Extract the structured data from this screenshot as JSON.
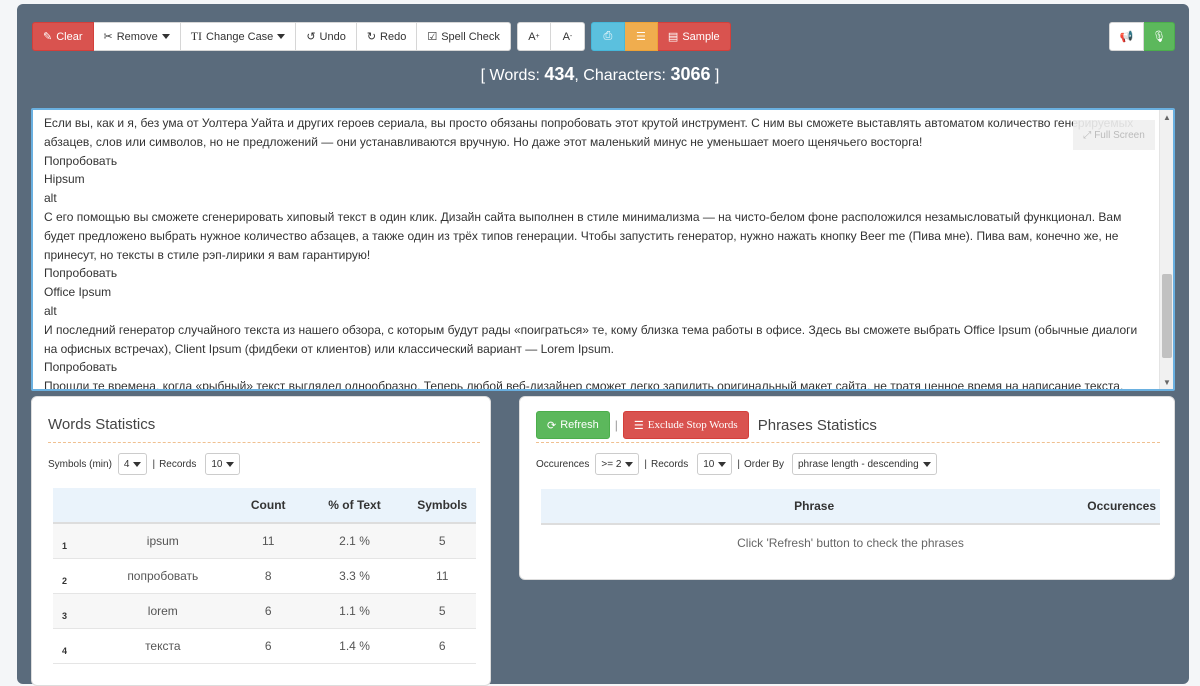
{
  "toolbar": {
    "clear": "Clear",
    "remove": "Remove",
    "change_case": "Change Case",
    "undo": "Undo",
    "redo": "Redo",
    "spell_check": "Spell Check",
    "font_up": "A",
    "font_up_sup": "+",
    "font_down": "A",
    "font_down_sup": "-",
    "sample": "Sample"
  },
  "counter": {
    "open": "[ ",
    "words_label": "Words:",
    "words_value": "434",
    "chars_label": ", Characters:",
    "chars_value": "3066",
    "close": " ]"
  },
  "editor": {
    "fullscreen_label": "Full Screen",
    "lines": [
      "Если вы, как и я, без ума от Уолтера Уайта и других героев сериала, вы просто обязаны попробовать этот крутой инструмент. С ним вы сможете выставлять автоматом количество генерируемых абзацев, слов или символов, но не предложений — они устанавливаются вручную. Но даже этот маленький минус не уменьшает моего щенячьего восторга!",
      "Попробовать",
      "Hipsum",
      " alt",
      "С его помощью вы сможете сгенерировать хиповый текст в один клик. Дизайн сайта выполнен в стиле минимализма — на чисто-белом фоне расположился незамысловатый функционал. Вам будет предложено выбрать нужное количество абзацев, а также один из трёх типов генерации. Чтобы запустить генератор, нужно нажать кнопку Beer me (Пива мне). Пива вам, конечно же, не принесут, но тексты в стиле рэп-лирики я вам гарантирую!",
      "Попробовать",
      "Office Ipsum",
      " alt",
      "И последний генератор случайного текста из нашего обзора, с которым будут рады «поиграться» те, кому близка тема работы в офисе. Здесь вы сможете выбрать Office Ipsum (обычные диалоги на офисных встречах), Client Ipsum (фидбеки от клиентов) или классический вариант — Lorem Ipsum.",
      "Попробовать",
      "Прошли те времена, когда «рыбный» текст выглядел однообразно. Теперь любой веб-дизайнер сможет легко запилить оригинальный макет сайта, не тратя ценное время на написание текста."
    ]
  },
  "words_stats": {
    "title": "Words Statistics",
    "symbols_label": "Symbols (min)",
    "symbols_value": "4",
    "sep": "|",
    "records_label": "Records",
    "records_value": "10",
    "columns": [
      "",
      "",
      "Count",
      "% of Text",
      "Symbols"
    ],
    "rows": [
      {
        "n": "1",
        "word": "ipsum",
        "count": "11",
        "pct": "2.1 %",
        "symbols": "5"
      },
      {
        "n": "2",
        "word": "попробовать",
        "count": "8",
        "pct": "3.3 %",
        "symbols": "11"
      },
      {
        "n": "3",
        "word": "lorem",
        "count": "6",
        "pct": "1.1 %",
        "symbols": "5"
      },
      {
        "n": "4",
        "word": "текста",
        "count": "6",
        "pct": "1.4 %",
        "symbols": "6"
      }
    ]
  },
  "phrases_stats": {
    "refresh": "Refresh",
    "sep": "|",
    "exclude": "Exclude Stop Words",
    "title": "Phrases Statistics",
    "occ_label": "Occurences",
    "occ_value": ">= 2",
    "records_label": "Records",
    "records_value": "10",
    "order_label": "Order By",
    "order_value": "phrase length - descending",
    "col_phrase": "Phrase",
    "col_occ": "Occurences",
    "empty": "Click 'Refresh' button to check the phrases"
  },
  "colors": {
    "frame": "#5a6b7c",
    "red": "#d9534f",
    "blue": "#5bc0de",
    "orange": "#f0ad4e",
    "green": "#5cb85c"
  }
}
